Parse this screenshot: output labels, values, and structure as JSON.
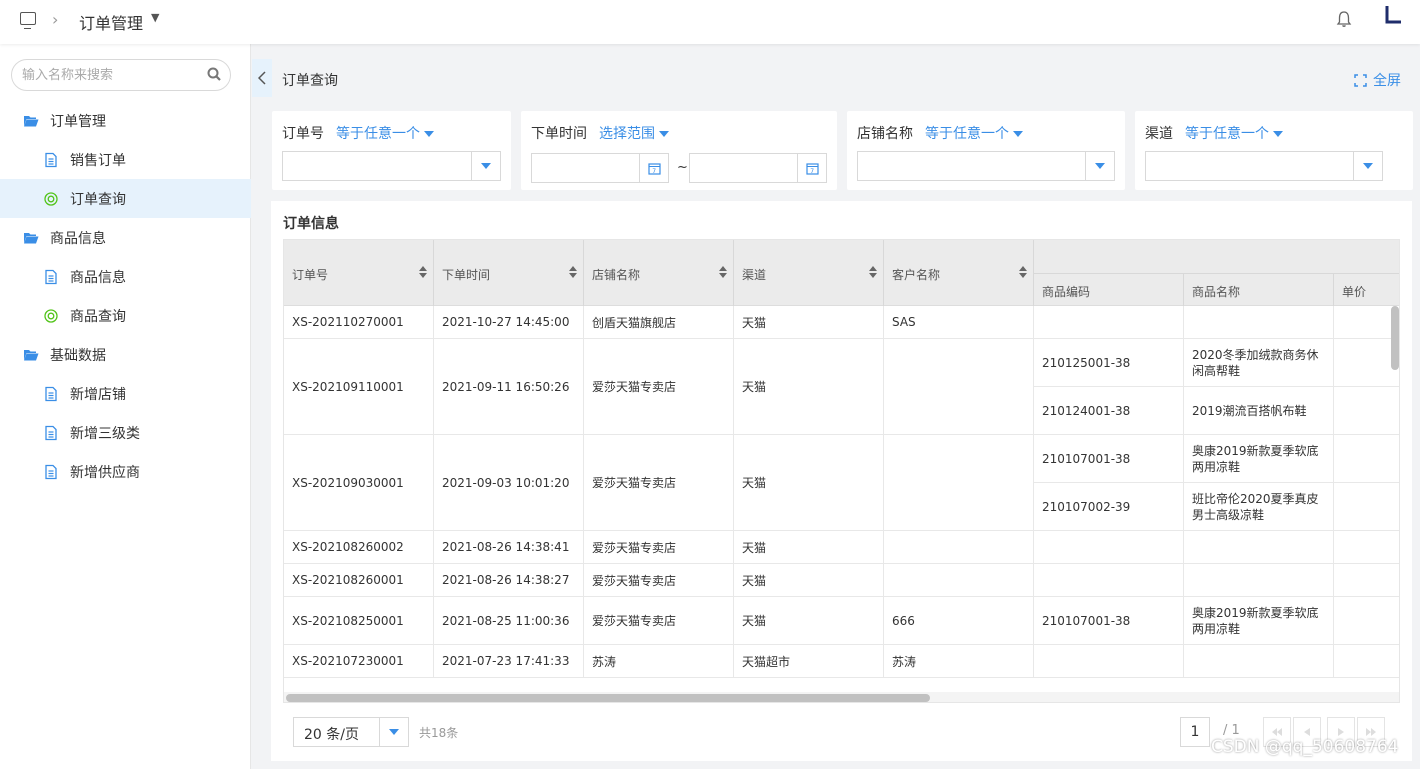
{
  "topbar": {
    "breadcrumb": "订单管理",
    "icons": [
      "monitor-icon",
      "chevron-right-icon",
      "caret-down-icon",
      "bell-icon",
      "logo-mark"
    ]
  },
  "sidebar": {
    "search_placeholder": "输入名称来搜索",
    "items": [
      {
        "label": "订单管理",
        "type": "group",
        "icon": "folder-open-icon"
      },
      {
        "label": "销售订单",
        "type": "child",
        "icon": "document-icon"
      },
      {
        "label": "订单查询",
        "type": "child",
        "icon": "target-icon",
        "active": true
      },
      {
        "label": "商品信息",
        "type": "group",
        "icon": "folder-open-icon"
      },
      {
        "label": "商品信息",
        "type": "child",
        "icon": "document-icon"
      },
      {
        "label": "商品查询",
        "type": "child",
        "icon": "target-icon"
      },
      {
        "label": "基础数据",
        "type": "group",
        "icon": "folder-open-icon"
      },
      {
        "label": "新增店铺",
        "type": "child",
        "icon": "document-icon"
      },
      {
        "label": "新增三级类",
        "type": "child",
        "icon": "document-icon"
      },
      {
        "label": "新增供应商",
        "type": "child",
        "icon": "document-icon"
      }
    ]
  },
  "main": {
    "title": "订单查询",
    "fullscreen_label": "全屏",
    "filters": {
      "order_no": {
        "label": "订单号",
        "op": "等于任意一个"
      },
      "order_time": {
        "label": "下单时间",
        "op": "选择范围",
        "sep": "~"
      },
      "shop": {
        "label": "店铺名称",
        "op": "等于任意一个"
      },
      "channel": {
        "label": "渠道",
        "op": "等于任意一个"
      }
    },
    "card_title": "订单信息",
    "columns": [
      "订单号",
      "下单时间",
      "店铺名称",
      "渠道",
      "客户名称"
    ],
    "sub_columns": [
      "商品编码",
      "商品名称",
      "单价"
    ],
    "rows": [
      {
        "order_no": "XS-202110270001",
        "time": "2021-10-27 14:45:00",
        "shop": "创盾天猫旗舰店",
        "channel": "天猫",
        "customer": "SAS",
        "items": [
          {
            "code": "",
            "name": "",
            "price": ""
          }
        ]
      },
      {
        "order_no": "XS-202109110001",
        "time": "2021-09-11 16:50:26",
        "shop": "爱莎天猫专卖店",
        "channel": "天猫",
        "customer": "",
        "items": [
          {
            "code": "210125001-38",
            "name": "2020冬季加绒款商务休闲高帮鞋",
            "price": ""
          },
          {
            "code": "210124001-38",
            "name": "2019潮流百搭帆布鞋",
            "price": ""
          }
        ]
      },
      {
        "order_no": "XS-202109030001",
        "time": "2021-09-03 10:01:20",
        "shop": "爱莎天猫专卖店",
        "channel": "天猫",
        "customer": "",
        "items": [
          {
            "code": "210107001-38",
            "name": "奥康2019新款夏季软底两用凉鞋",
            "price": ""
          },
          {
            "code": "210107002-39",
            "name": "班比帝伦2020夏季真皮男士高级凉鞋",
            "price": ""
          }
        ]
      },
      {
        "order_no": "XS-202108260002",
        "time": "2021-08-26 14:38:41",
        "shop": "爱莎天猫专卖店",
        "channel": "天猫",
        "customer": "",
        "items": [
          {
            "code": "",
            "name": "",
            "price": ""
          }
        ]
      },
      {
        "order_no": "XS-202108260001",
        "time": "2021-08-26 14:38:27",
        "shop": "爱莎天猫专卖店",
        "channel": "天猫",
        "customer": "",
        "items": [
          {
            "code": "",
            "name": "",
            "price": ""
          }
        ]
      },
      {
        "order_no": "XS-202108250001",
        "time": "2021-08-25 11:00:36",
        "shop": "爱莎天猫专卖店",
        "channel": "天猫",
        "customer": "666",
        "items": [
          {
            "code": "210107001-38",
            "name": "奥康2019新款夏季软底两用凉鞋",
            "price": ""
          }
        ]
      },
      {
        "order_no": "XS-202107230001",
        "time": "2021-07-23 17:41:33",
        "shop": "苏涛",
        "channel": "天猫超市",
        "customer": "苏涛",
        "items": [
          {
            "code": "",
            "name": "",
            "price": ""
          }
        ]
      }
    ],
    "pager": {
      "page_size": "20 条/页",
      "total": "共18条",
      "current": "1",
      "of": "/ 1"
    }
  },
  "watermark": "CSDN @qq_50608764",
  "colors": {
    "accent": "#3a8ee6",
    "active_bg": "#e6f2fc",
    "header_bg": "#ebebeb"
  }
}
